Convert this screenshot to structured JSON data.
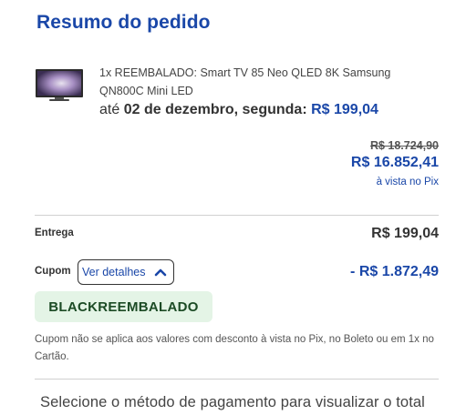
{
  "order": {
    "title": "Resumo do pedido"
  },
  "product": {
    "name": "1x REEMBALADO: Smart TV 85 Neo QLED 8K Samsung QN800C Mini LED",
    "thumbnail_icon": "tv-thumbnail",
    "delivery_prefix": "até",
    "delivery_date": "02 de dezembro, segunda:",
    "delivery_price": "R$ 199,04"
  },
  "prices": {
    "original": "R$ 18.724,90",
    "pix": "R$ 16.852,41",
    "pix_note": "à vista no Pix"
  },
  "shipping": {
    "label": "Entrega",
    "value": "R$ 199,04"
  },
  "coupon": {
    "label": "Cupom",
    "details_button": "Ver detalhes",
    "discount": "- R$ 1.872,49",
    "code": "BLACKREEMBALADO",
    "note": "Cupom não se aplica aos valores com desconto à vista no Pix, no Boleto ou em 1x no Cartão."
  },
  "footer": {
    "message": "Selecione o método de pagamento para visualizar o total"
  },
  "colors": {
    "accent": "#1a47a8",
    "discount": "#1a47a8",
    "coupon_bg": "#e4f4e6",
    "coupon_text": "#1c4b25"
  }
}
